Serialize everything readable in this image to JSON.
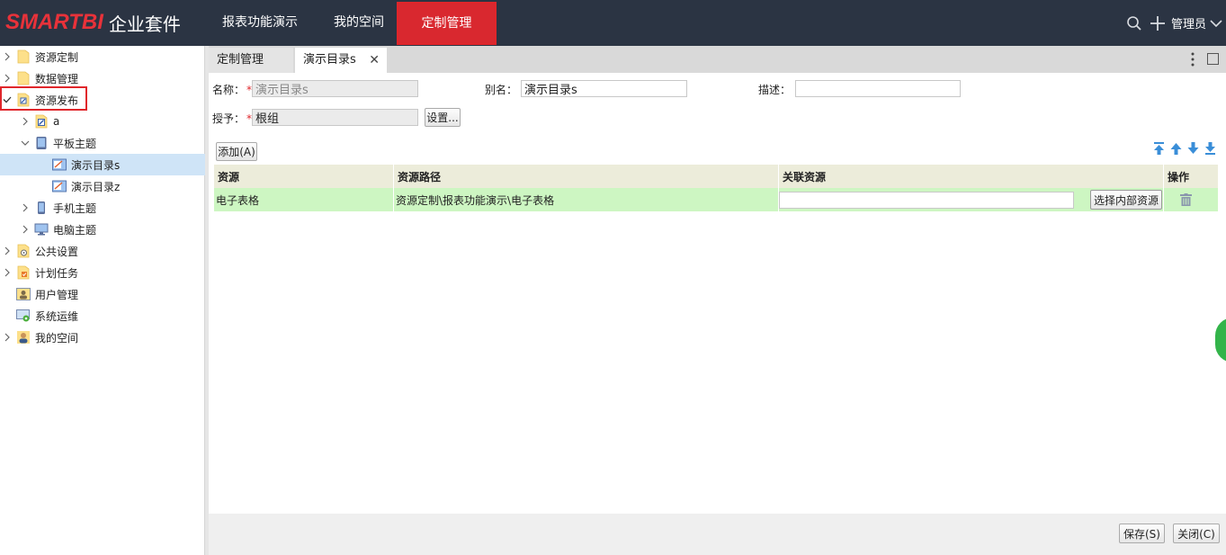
{
  "app": {
    "brand": "SMARTBI",
    "suite": "企业套件",
    "accent_color": "#d9282f",
    "topbar_color": "#2b3443"
  },
  "nav": {
    "tabs": [
      {
        "label": "报表功能演示"
      },
      {
        "label": "我的空间"
      },
      {
        "label": "定制管理",
        "active": true
      }
    ]
  },
  "topright": {
    "search_icon": "search-icon",
    "add_icon": "plus-icon",
    "user": "管理员"
  },
  "sidebar": {
    "items": [
      {
        "label": "资源定制",
        "icon": "folder-icon",
        "level": 0,
        "toggle": "collapsed"
      },
      {
        "label": "数据管理",
        "icon": "folder-icon",
        "level": 0,
        "toggle": "collapsed"
      },
      {
        "label": "资源发布",
        "icon": "publish-folder-icon",
        "level": 0,
        "toggle": "expanded-check"
      },
      {
        "label": "a",
        "icon": "publish-icon",
        "level": 1,
        "toggle": "collapsed"
      },
      {
        "label": "平板主题",
        "icon": "tablet-icon",
        "level": 1,
        "toggle": "expanded"
      },
      {
        "label": "演示目录s",
        "icon": "catalog-icon",
        "level": 2,
        "toggle": "none",
        "selected": true
      },
      {
        "label": "演示目录z",
        "icon": "catalog-icon",
        "level": 2,
        "toggle": "none"
      },
      {
        "label": "手机主题",
        "icon": "phone-icon",
        "level": 1,
        "toggle": "collapsed"
      },
      {
        "label": "电脑主题",
        "icon": "monitor-icon",
        "level": 1,
        "toggle": "collapsed"
      },
      {
        "label": "公共设置",
        "icon": "settings-folder-icon",
        "level": 0,
        "toggle": "collapsed"
      },
      {
        "label": "计划任务",
        "icon": "task-folder-icon",
        "level": 0,
        "toggle": "collapsed"
      },
      {
        "label": "用户管理",
        "icon": "user-manage-icon",
        "level": 0,
        "toggle": "none"
      },
      {
        "label": "系统运维",
        "icon": "ops-icon",
        "level": 0,
        "toggle": "none"
      },
      {
        "label": "我的空间",
        "icon": "person-icon",
        "level": 0,
        "toggle": "collapsed"
      }
    ]
  },
  "tabs": {
    "items": [
      {
        "label": "定制管理"
      },
      {
        "label": "演示目录s",
        "closable": true
      }
    ]
  },
  "form": {
    "name_label": "名称：",
    "name_value": "演示目录s",
    "alias_label": "别名：",
    "alias_value": "演示目录s",
    "desc_label": "描述：",
    "desc_value": "",
    "grant_label": "授予：",
    "grant_value": "根组",
    "setting_button": "设置...",
    "required_mark": "*"
  },
  "toolbar": {
    "add_button": "添加(A)"
  },
  "grid": {
    "columns": [
      "资源",
      "资源路径",
      "关联资源",
      "操作"
    ],
    "rows": [
      {
        "resource": "电子表格",
        "path": "资源定制\\报表功能演示\\电子表格",
        "link": "",
        "pick_button": "选择内部资源"
      }
    ]
  },
  "footer": {
    "save_button": "保存(S)",
    "close_button": "关闭(C)"
  }
}
